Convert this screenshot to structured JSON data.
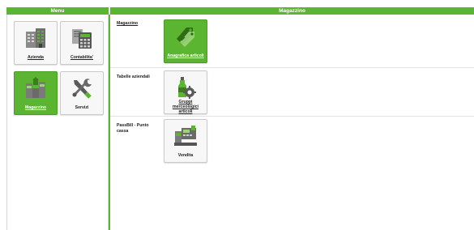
{
  "header": {
    "menu_title": "Menu",
    "main_title": "Magazzino"
  },
  "menu": {
    "items": [
      {
        "label": "Azienda",
        "icon": "building-icon",
        "active": false
      },
      {
        "label": "Contabilita'",
        "icon": "calculator-icon",
        "active": false
      },
      {
        "label": "Magazzino",
        "icon": "warehouse-icon",
        "active": true
      },
      {
        "label": "Servizi",
        "icon": "tools-icon",
        "active": false
      }
    ]
  },
  "sections": [
    {
      "title": "Magazzino",
      "tile": {
        "label": "Anagrafica articoli",
        "icon": "tags-icon",
        "active": true
      }
    },
    {
      "title": "Tabelle aziendali",
      "tile": {
        "label": "Gruppi merceologici articoli",
        "icon": "bottle-gear-icon",
        "active": false
      }
    },
    {
      "title": "PassBill - Punto cassa",
      "tile": {
        "label": "Vendita",
        "icon": "cash-register-icon",
        "active": false
      }
    }
  ],
  "colors": {
    "accent": "#5cb531",
    "icon_gray": "#7a7a7a",
    "icon_green": "#5cb531"
  }
}
